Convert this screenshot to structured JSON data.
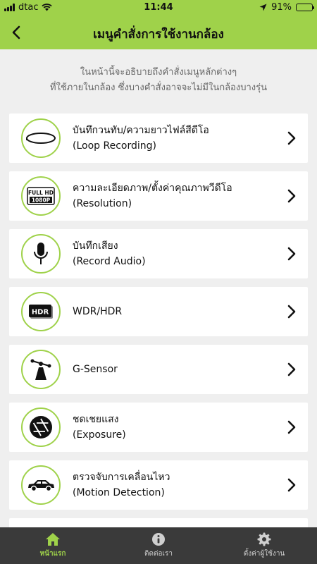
{
  "status_bar": {
    "carrier": "dtac",
    "time": "11:44",
    "battery_percent_label": "91%",
    "battery_level": 0.91
  },
  "header": {
    "title": "เมนูคำสั่งการใช้งานกล้อง",
    "back_icon": "chevron-left-icon"
  },
  "intro": {
    "line1": "ในหน้านี้จะอธิบายถึงคำสั่งเมนูหลักต่างๆ",
    "line2": "ที่ใช้ภายในกล้อง ซึ่งบางคำสั่งอาจจะไม่มีในกล้องบางรุ่น"
  },
  "menu": {
    "items": [
      {
        "title": "บันทึกวนทับ/ความยาวไฟล์สีดีโอ",
        "subtitle": "(Loop Recording)",
        "icon": "loop-recording-icon"
      },
      {
        "title": "ความละเอียดภาพ/ตั้งค่าคุณภาพวีดีโอ",
        "subtitle": "(Resolution)",
        "icon": "full-hd-icon",
        "icon_text_top": "FULL HD",
        "icon_text_bottom": "1080P"
      },
      {
        "title": "บันทึกเสียง",
        "subtitle": "(Record Audio)",
        "icon": "microphone-icon"
      },
      {
        "title": "WDR/HDR",
        "subtitle": "",
        "icon": "hdr-icon",
        "icon_text": "HDR"
      },
      {
        "title": "G-Sensor",
        "subtitle": "",
        "icon": "g-sensor-icon"
      },
      {
        "title": "ชดเชยแสง",
        "subtitle": "(Exposure)",
        "icon": "aperture-icon"
      },
      {
        "title": "ตรวจจับการเคลื่อนไหว",
        "subtitle": "(Motion Detection)",
        "icon": "car-icon"
      }
    ]
  },
  "tabs": [
    {
      "label": "หน้าแรก",
      "icon": "home-icon",
      "active": true
    },
    {
      "label": "ติดต่อเรา",
      "icon": "info-icon",
      "active": false
    },
    {
      "label": "ตั้งค่าผู้ใช้งาน",
      "icon": "gear-icon",
      "active": false
    }
  ],
  "colors": {
    "accent": "#9fd24a",
    "tabbar": "#3a3a3a",
    "background": "#efefef"
  }
}
